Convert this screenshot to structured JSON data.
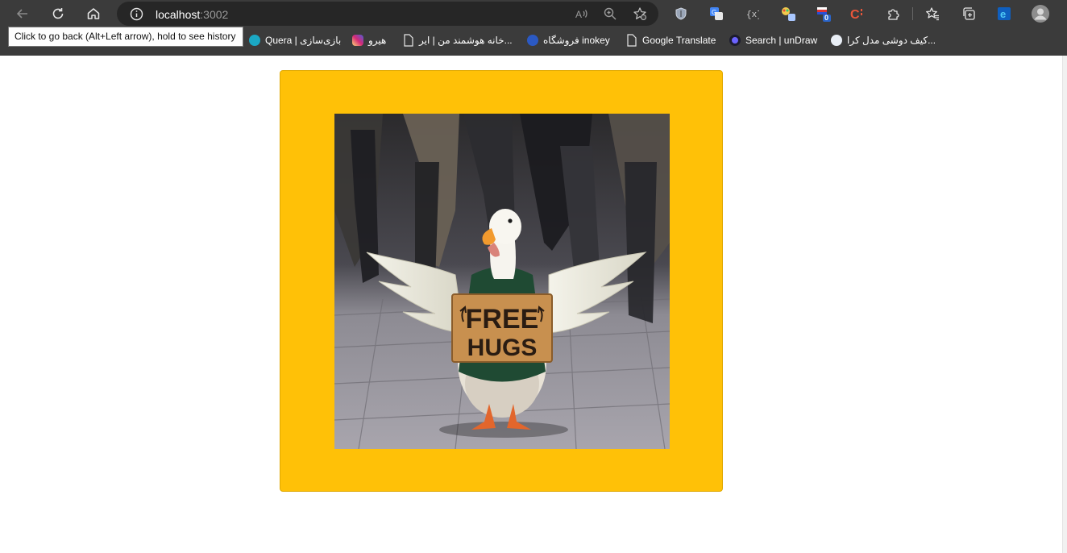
{
  "browser": {
    "url_host": "localhost",
    "url_port": ":3002",
    "tooltip": "Click to go back (Alt+Left arrow), hold to see history",
    "extension_badge": "0",
    "bookmarks": [
      {
        "label": "Quera | بازی‌سازی",
        "icon": "quera-icon",
        "color": "#1ba8c4"
      },
      {
        "label": "هیرو",
        "icon": "instagram-icon",
        "color": "#d62976"
      },
      {
        "label": "خانه هوشمند من | ایر...",
        "icon": "page-icon",
        "color": "#ffffff"
      },
      {
        "label": "فروشگاه inokey",
        "icon": "inokey-icon",
        "color": "#2b59c3"
      },
      {
        "label": "Google Translate",
        "icon": "page-icon",
        "color": "#ffffff"
      },
      {
        "label": "Search | unDraw",
        "icon": "undraw-icon",
        "color": "#6c63ff"
      },
      {
        "label": "کیف دوشی مدل کرا...",
        "icon": "shop-icon",
        "color": "#4a90d9"
      }
    ]
  },
  "main": {
    "card_color": "#ffc107",
    "image_alt": "Duck wearing a sign",
    "sign_line_1": "FREE",
    "sign_line_2": "HUGS"
  }
}
